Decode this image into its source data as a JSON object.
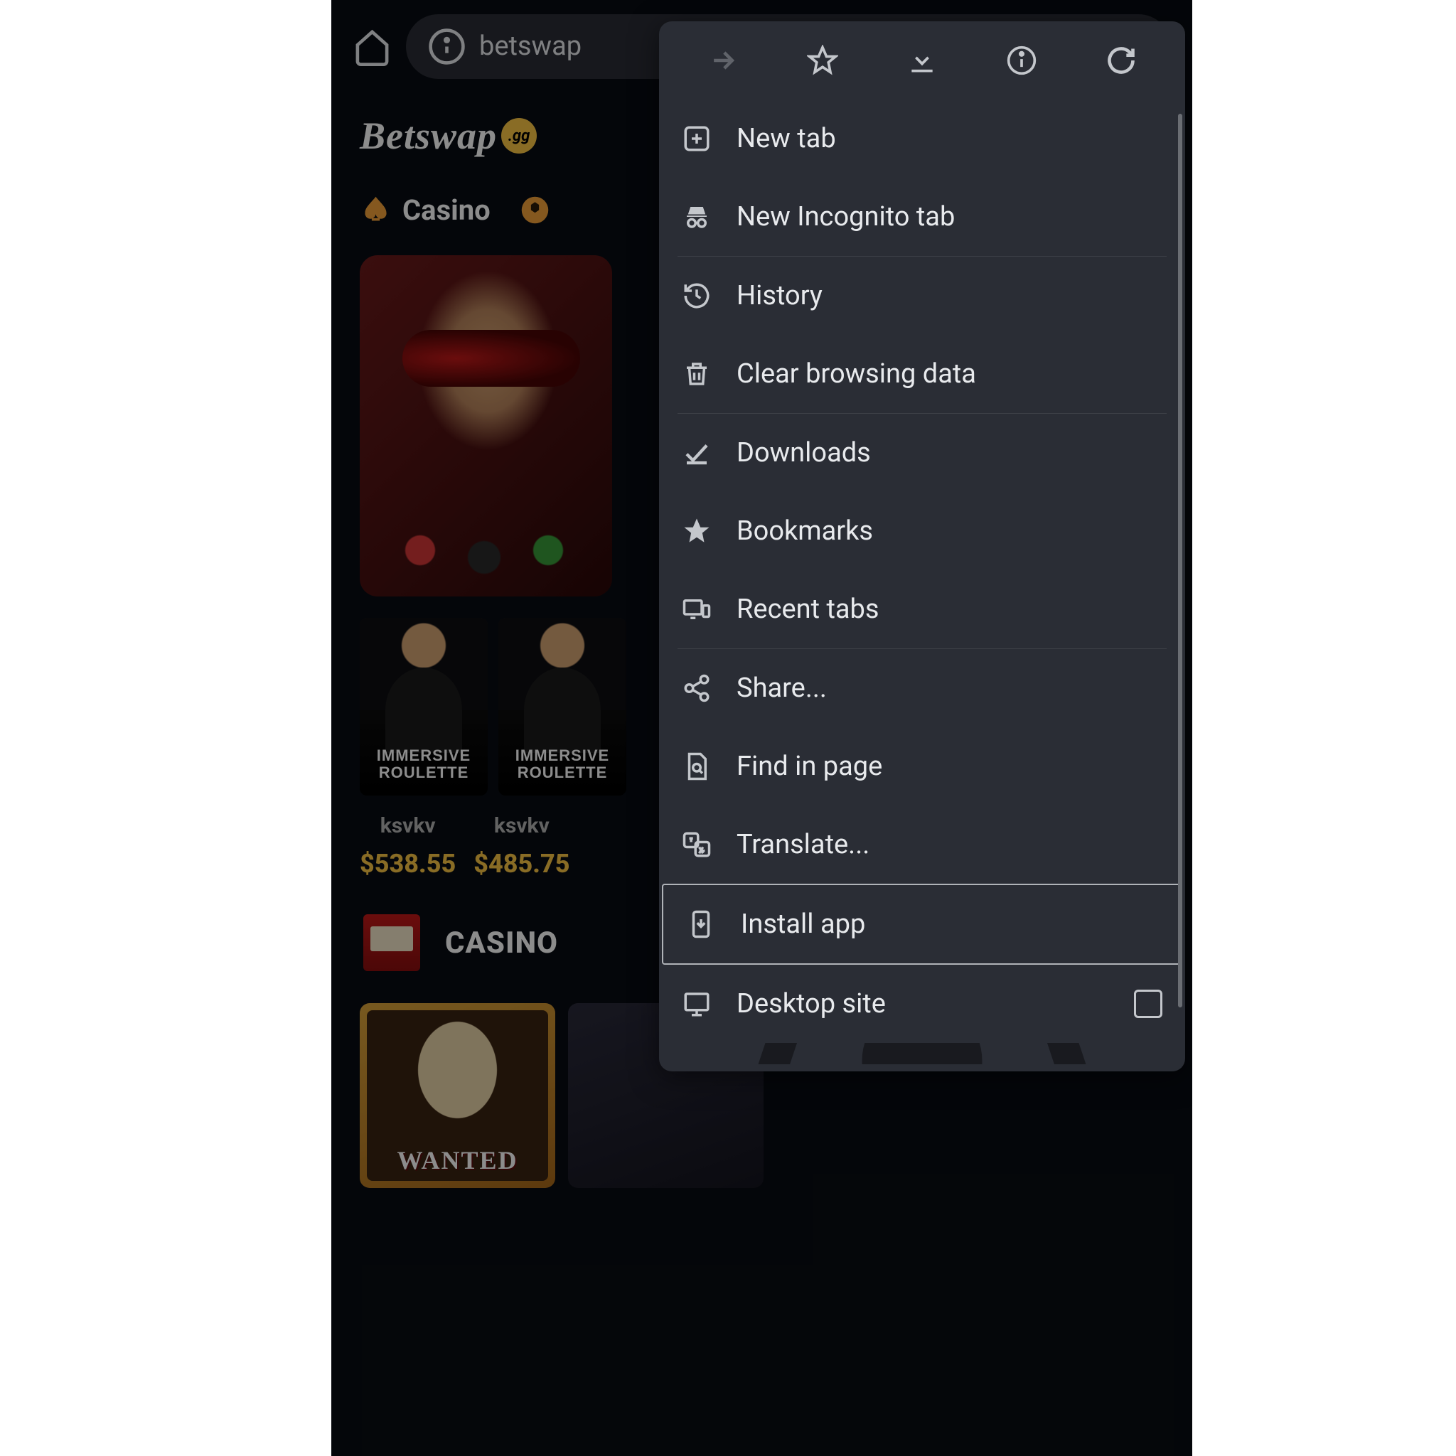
{
  "browser": {
    "url": "betswap"
  },
  "site": {
    "logo": "Betswap",
    "logo_badge": ".gg",
    "tabs": {
      "casino": "Casino"
    },
    "games": {
      "immersive": "IMMERSIVE\nROULETTE"
    },
    "winners": [
      {
        "name": "ksvkv",
        "amount": "$538.55"
      },
      {
        "name": "ksvkv",
        "amount": "$485.75"
      }
    ],
    "casino_heading": "CASINO",
    "wanted": "WANTED"
  },
  "menu": {
    "new_tab": "New tab",
    "incognito": "New Incognito tab",
    "history": "History",
    "clear": "Clear browsing data",
    "downloads": "Downloads",
    "bookmarks": "Bookmarks",
    "recent": "Recent tabs",
    "share": "Share...",
    "find": "Find in page",
    "translate": "Translate...",
    "install": "Install app",
    "desktop": "Desktop site"
  }
}
